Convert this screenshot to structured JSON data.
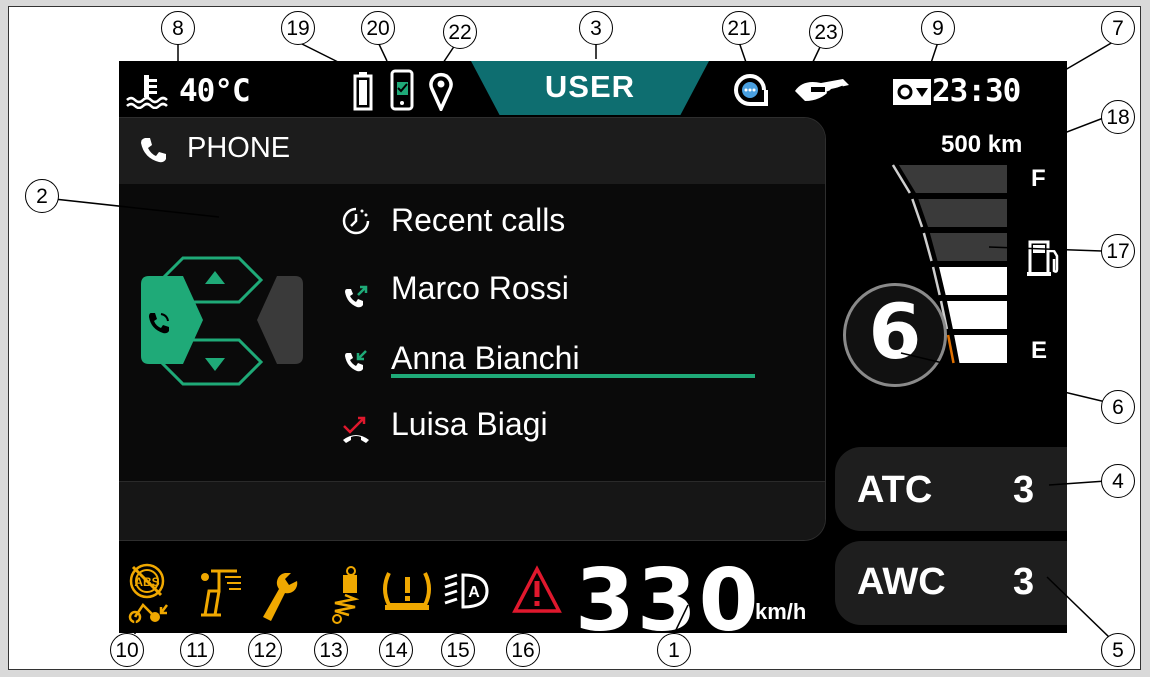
{
  "top_bar": {
    "temperature": "40°C",
    "mode": "USER",
    "clock": "23:30"
  },
  "phone": {
    "title": "PHONE",
    "recent_calls_label": "Recent calls",
    "contacts": [
      {
        "name": "Marco Rossi",
        "type": "outgoing",
        "selected": true
      },
      {
        "name": "Anna Bianchi",
        "type": "incoming",
        "selected": false
      },
      {
        "name": "Luisa Biagi",
        "type": "missed",
        "selected": false
      }
    ]
  },
  "fuel": {
    "range": "500 km",
    "full_label": "F",
    "empty_label": "E",
    "level_segments_lit": 3,
    "segments_total": 6
  },
  "gear": "6",
  "modes": {
    "atc": {
      "label": "ATC",
      "value": "3"
    },
    "awc": {
      "label": "AWC",
      "value": "3"
    }
  },
  "speed": {
    "value": "330",
    "unit": "km/h"
  },
  "warning_icons": [
    "abs-off-icon",
    "pit-limiter-icon",
    "service-wrench-icon",
    "suspension-icon",
    "tpms-icon",
    "auto-headlight-icon",
    "general-warning-icon"
  ],
  "status_icons": [
    "battery-icon",
    "phone-connected-icon",
    "navigation-icon",
    "message-icon",
    "quickshift-icon",
    "settings-menu-icon",
    "coolant-temp-icon"
  ],
  "callouts": [
    "1",
    "2",
    "3",
    "4",
    "5",
    "6",
    "7",
    "8",
    "9",
    "10",
    "11",
    "12",
    "13",
    "14",
    "15",
    "16",
    "17",
    "18",
    "19",
    "20",
    "21",
    "22",
    "23"
  ],
  "colors": {
    "accent_green": "#1faa78",
    "mode_tab": "#0e6e70",
    "warning_amber": "#f0a800",
    "warning_red": "#e0182d",
    "message_blue": "#4aa0e0"
  }
}
